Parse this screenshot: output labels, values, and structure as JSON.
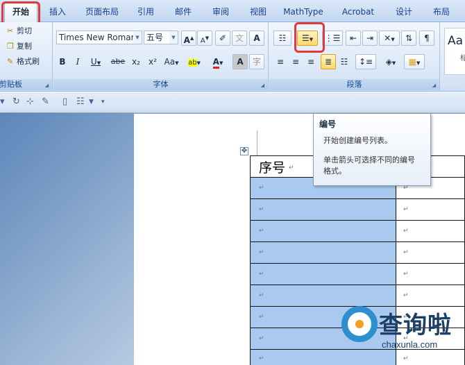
{
  "tabs": [
    "开始",
    "插入",
    "页面布局",
    "引用",
    "邮件",
    "审阅",
    "视图",
    "MathType",
    "Acrobat",
    "设计",
    "布局"
  ],
  "clipboard": {
    "cut": "剪切",
    "copy": "复制",
    "format_painter": "格式刷",
    "group_label": "剪贴板"
  },
  "font": {
    "family": "Times New Romar",
    "size": "五号",
    "grow": "A",
    "shrink": "A",
    "bold": "B",
    "italic": "I",
    "underline": "U",
    "strike": "abe",
    "subscript": "x₂",
    "superscript": "x²",
    "case": "Aa",
    "highlight": "ab",
    "color": "A",
    "shade": "A",
    "char_border": "A",
    "phonetic": "文",
    "enclose": "字",
    "group_label": "字体"
  },
  "paragraph": {
    "group_label": "段落"
  },
  "styles": {
    "sample": "Aa",
    "caption": "标"
  },
  "tooltip": {
    "title": "编号",
    "line1": "开始创建编号列表。",
    "line2": "单击箭头可选择不同的编号",
    "line3": "格式。"
  },
  "table": {
    "header": "序号",
    "mark": "↵"
  },
  "watermark": {
    "text": "查询啦",
    "url": "chaxunla.com"
  },
  "colors": {
    "highlight_red": "#e03a3a",
    "selection_blue": "#a9c9ef",
    "ribbon_text": "#15428b"
  }
}
